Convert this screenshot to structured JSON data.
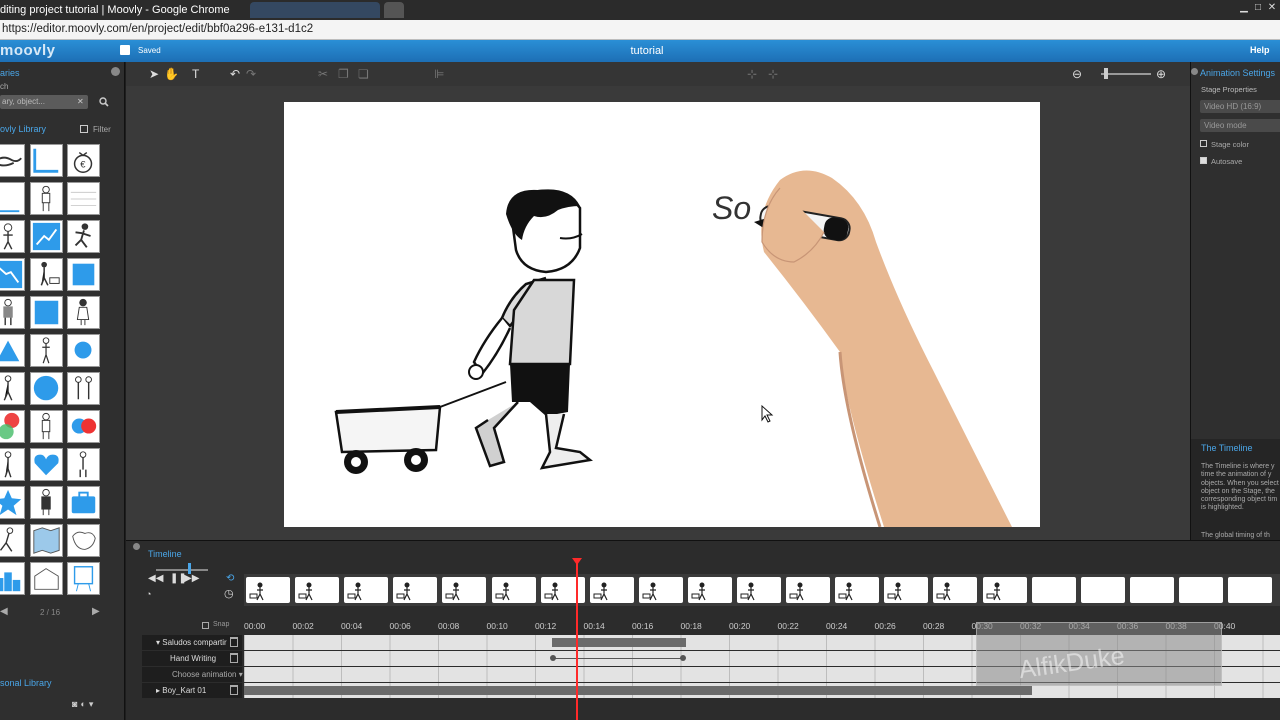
{
  "browser": {
    "window_title": "diting project tutorial | Moovly - Google Chrome",
    "url": "https://editor.moovly.com/en/project/edit/bbf0a296-e131-d1c2"
  },
  "app": {
    "logo": "moovly",
    "save_status": "Saved",
    "project_name": "tutorial",
    "help_label": "Help"
  },
  "library": {
    "section_title": "aries",
    "search_label": "ch",
    "search_placeholder": "ary, object...",
    "library_title": "ovly Library",
    "filter_label": "Filter",
    "page_indicator": "2 / 16",
    "personal_library": "sonal Library"
  },
  "stage": {
    "handwriting_text": "So"
  },
  "settings": {
    "title": "Animation Settings",
    "stage_properties": "Stage Properties",
    "video_format": "Video HD (16:9)",
    "video_mode": "Video mode",
    "stage_color_label": "Stage color",
    "autosave_label": "Autosave",
    "help_title": "The Timeline",
    "help_body": "The Timeline is where y time the animation of y objects. When you select object on the Stage, the corresponding object tim is highlighted.",
    "help_footer": "The global timing of th"
  },
  "timeline": {
    "title": "Timeline",
    "snap_label": "Snap",
    "ticks": [
      "00:00",
      "00:02",
      "00:04",
      "00:06",
      "00:08",
      "00:10",
      "00:12",
      "00:14",
      "00:16",
      "00:18",
      "00:20",
      "00:22",
      "00:24",
      "00:26",
      "00:28",
      "00:30",
      "00:32",
      "00:34",
      "00:36",
      "00:38",
      "00:40"
    ],
    "tracks": [
      {
        "name": "Saludos compartir"
      },
      {
        "name": "Hand Writing"
      },
      {
        "name": "Choose animation"
      },
      {
        "name": "Boy_Kart 01"
      }
    ]
  },
  "colors": {
    "accent": "#4aa6e8",
    "appbar": "#1d6fb5",
    "playhead": "#ff2a2a"
  }
}
